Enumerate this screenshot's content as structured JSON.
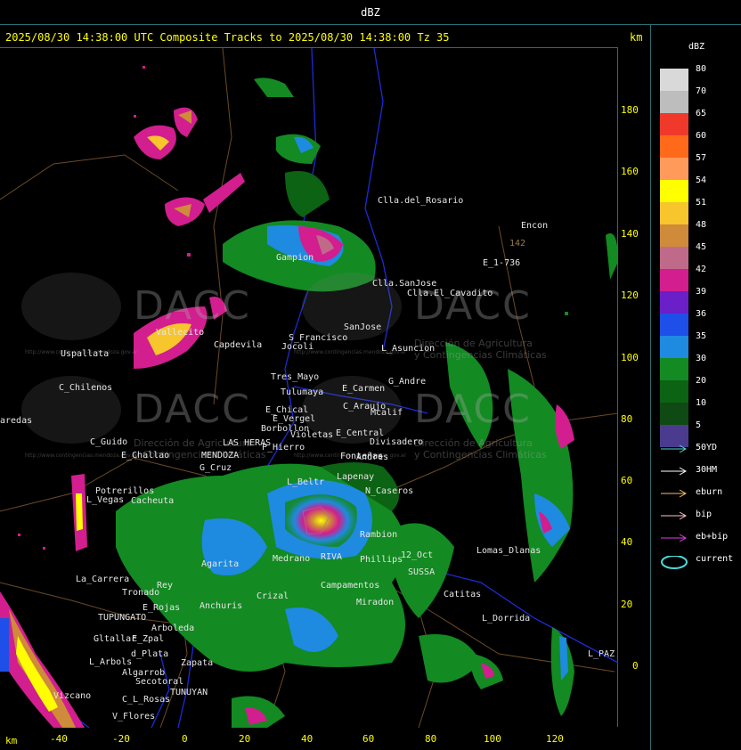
{
  "header": {
    "title": "dBZ"
  },
  "subtitle": "2025/08/30 14:38:00 UTC Composite Tracks to 2025/08/30 14:38:00 Tz 35",
  "axis": {
    "unit_top": "km",
    "unit_bottom": "km",
    "y_ticks": [
      "180",
      "160",
      "140",
      "120",
      "100",
      "80",
      "60",
      "40",
      "20",
      "0"
    ],
    "x_ticks": [
      "-40",
      "-20",
      "0",
      "20",
      "40",
      "60",
      "80",
      "100",
      "120"
    ]
  },
  "legend": {
    "title": "dBZ",
    "scale": [
      {
        "label": "80",
        "color": "#d9d9d9"
      },
      {
        "label": "70",
        "color": "#bdbdbd"
      },
      {
        "label": "65",
        "color": "#f0392b"
      },
      {
        "label": "60",
        "color": "#ff6a1a"
      },
      {
        "label": "57",
        "color": "#ff9a5a"
      },
      {
        "label": "54",
        "color": "#ffff00"
      },
      {
        "label": "51",
        "color": "#f7c52c"
      },
      {
        "label": "48",
        "color": "#cf8a3a"
      },
      {
        "label": "45",
        "color": "#c06a8a"
      },
      {
        "label": "42",
        "color": "#d21e8e"
      },
      {
        "label": "39",
        "color": "#6a1fc8"
      },
      {
        "label": "36",
        "color": "#1e4fe8"
      },
      {
        "label": "35",
        "color": "#1e8ae0"
      },
      {
        "label": "30",
        "color": "#138a22"
      },
      {
        "label": "20",
        "color": "#0b6313"
      },
      {
        "label": "10",
        "color": "#0f4a14"
      },
      {
        "label": "5",
        "color": "#4b3b8e"
      }
    ],
    "tracks": [
      {
        "label": "50YD",
        "color": "#4fd6d6",
        "icon": "arrow-icon"
      },
      {
        "label": "30HM",
        "color": "#ffffff",
        "icon": "arrow-icon"
      },
      {
        "label": "eburn",
        "color": "#f2c16a",
        "icon": "arrow-icon"
      },
      {
        "label": "bip",
        "color": "#ffc0c8",
        "icon": "arrow-icon"
      },
      {
        "label": "eb+bip",
        "color": "#e040e0",
        "icon": "arrow-icon"
      },
      {
        "label": "current",
        "color": "#4fd6d6",
        "icon": "ellipse-icon"
      }
    ]
  },
  "places": [
    "Clla.del_Rosario",
    "Encon",
    "142",
    "E_1-736",
    "Gampion",
    "Clla.SanJose",
    "Clla.El_Cavadito",
    "Vallecito",
    "Capdevila",
    "S_Francisco",
    "Jocoli",
    "SanJose",
    "L_Asuncion",
    "Uspallata",
    "Tres_Mayo",
    "Tulumaya",
    "E_Carmen",
    "G_Andre",
    "C_Chilenos",
    "E_Chical",
    "E_Vergel",
    "C_Araujo",
    "Mcalif",
    "aredas",
    "Borbollon",
    "Violetas",
    "E_Central",
    "Divisadero",
    "C_Guido",
    "LAS HERAS",
    "P_Hierro",
    "E_Challao",
    "MENDOZA",
    "Fonteñas",
    "Lapenay",
    "G_Cruz",
    "L_Beltr",
    "Potrerillos",
    "Cacheuta",
    "L_Vegas",
    "N_Caseros",
    "Rambion",
    "Lomas_Dlanas",
    "Medrano",
    "RIVA",
    "Phillips",
    "12_Oct",
    "SUSSA",
    "La_Carrera",
    "Agarita",
    "Anchuris",
    "Crizal",
    "Campamentos",
    "Catitas",
    "Rey",
    "Tronado",
    "E_Rojas",
    "TUPUNGATO",
    "Arboleda",
    "L_Dorrida",
    "Gltallar",
    "E_Zpal",
    "d_Plata",
    "Zapata",
    "L_Arbols",
    "Secotoral",
    "TUNUYAN",
    "Algarrob",
    "C_L_Rosas",
    "Vizcano",
    "V_Flores",
    "L_PAZ",
    "Andres",
    "Miradon"
  ],
  "watermark": {
    "brand": "DACC",
    "line1": "Dirección de Agricultura",
    "line2": "y Contingencias Climáticas",
    "url": "http://www.contingencias.mendoza.gov.ar"
  }
}
